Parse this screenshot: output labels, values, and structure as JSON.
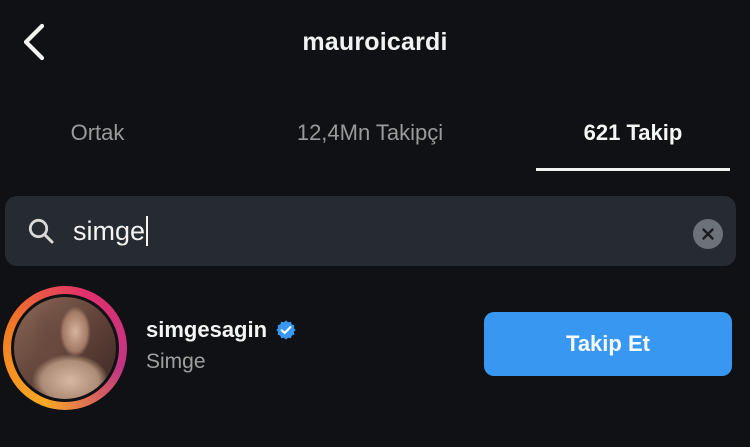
{
  "header": {
    "title": "mauroicardi"
  },
  "tabs": [
    {
      "label": "Ortak"
    },
    {
      "label": "12,4Mn Takipçi"
    },
    {
      "label": "621 Takip"
    }
  ],
  "active_tab_index": 2,
  "search": {
    "value": "simge"
  },
  "results": [
    {
      "username": "simgesagin",
      "full_name": "Simge",
      "verified": true,
      "action_label": "Takip Et"
    }
  ],
  "colors": {
    "background": "#0f1115",
    "search_bg": "#262a31",
    "primary_button": "#3897f0",
    "verified_badge": "#3897f0",
    "story_ring": [
      "#f9a825",
      "#f27b21",
      "#e1306c",
      "#c13584"
    ]
  },
  "icons": {
    "back": "back-icon",
    "search": "search-icon",
    "clear": "clear-icon",
    "verified": "verified-badge-icon"
  }
}
